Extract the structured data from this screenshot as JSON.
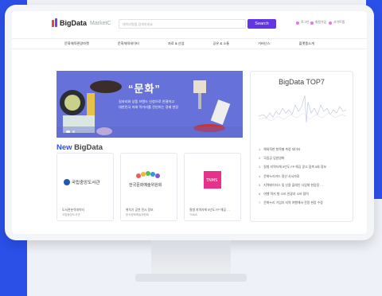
{
  "header": {
    "logo_text": "BigData",
    "logo_sub": "MarketC",
    "search_placeholder": "데이터명을 검색하세요",
    "search_button": "Search",
    "util_links": [
      "로그인",
      "회원가입",
      "사이트맵"
    ]
  },
  "nav": {
    "items": [
      "문화체육관광마켓",
      "문화체육데이터",
      "자료 & 산업",
      "공유 & 소통",
      "거버넌스",
      "플랫폼소개"
    ]
  },
  "banner": {
    "title": "“문화”",
    "line1": "일자리와 상품 브랜드 신청으로 연결하고",
    "line2": "대한민국 미래 먹거리를 견인하는 경제 현장"
  },
  "top7": {
    "title": "BigData TOP7",
    "items": [
      {
        "num": "1.",
        "label": "해외직판 항목별 측정 데이터"
      },
      {
        "num": "2.",
        "label": "국립공 입방영화"
      },
      {
        "num": "3.",
        "label": "질병 지역자체 5년도 FP 해공 광고 접촉 5회 정보"
      },
      {
        "num": "4.",
        "label": "문화누리카드 정산 사서자료"
      },
      {
        "num": "5.",
        "label": "지역베이터스 및 신용 플레인 사업체 현장정 …"
      },
      {
        "num": "6.",
        "label": "여행 역지 형 소비 관광과 소비 협력"
      },
      {
        "num": "7.",
        "label": "문화누리 가입자 지역 여행해서 전망 현장 수정"
      }
    ]
  },
  "new_bigdata": {
    "title_accent": "New",
    "title_rest": " BigData",
    "cards": [
      {
        "logo": "국립중앙도서관",
        "line1": "도서관분석데이터",
        "line2": "국립중앙도서관"
      },
      {
        "logo": "한국문화예술위원회",
        "line1": "위치기 공연 전시 정보",
        "line2": "한국문화예술위원회"
      },
      {
        "logo": "TNMS",
        "line1": "질병 지역자체 5년도 FP 해공 …",
        "line2": "TNMS"
      }
    ]
  },
  "colors": {
    "brand_blue": "#2b50e8",
    "search_purple": "#6236e0",
    "banner_bg": "#6672d9"
  }
}
